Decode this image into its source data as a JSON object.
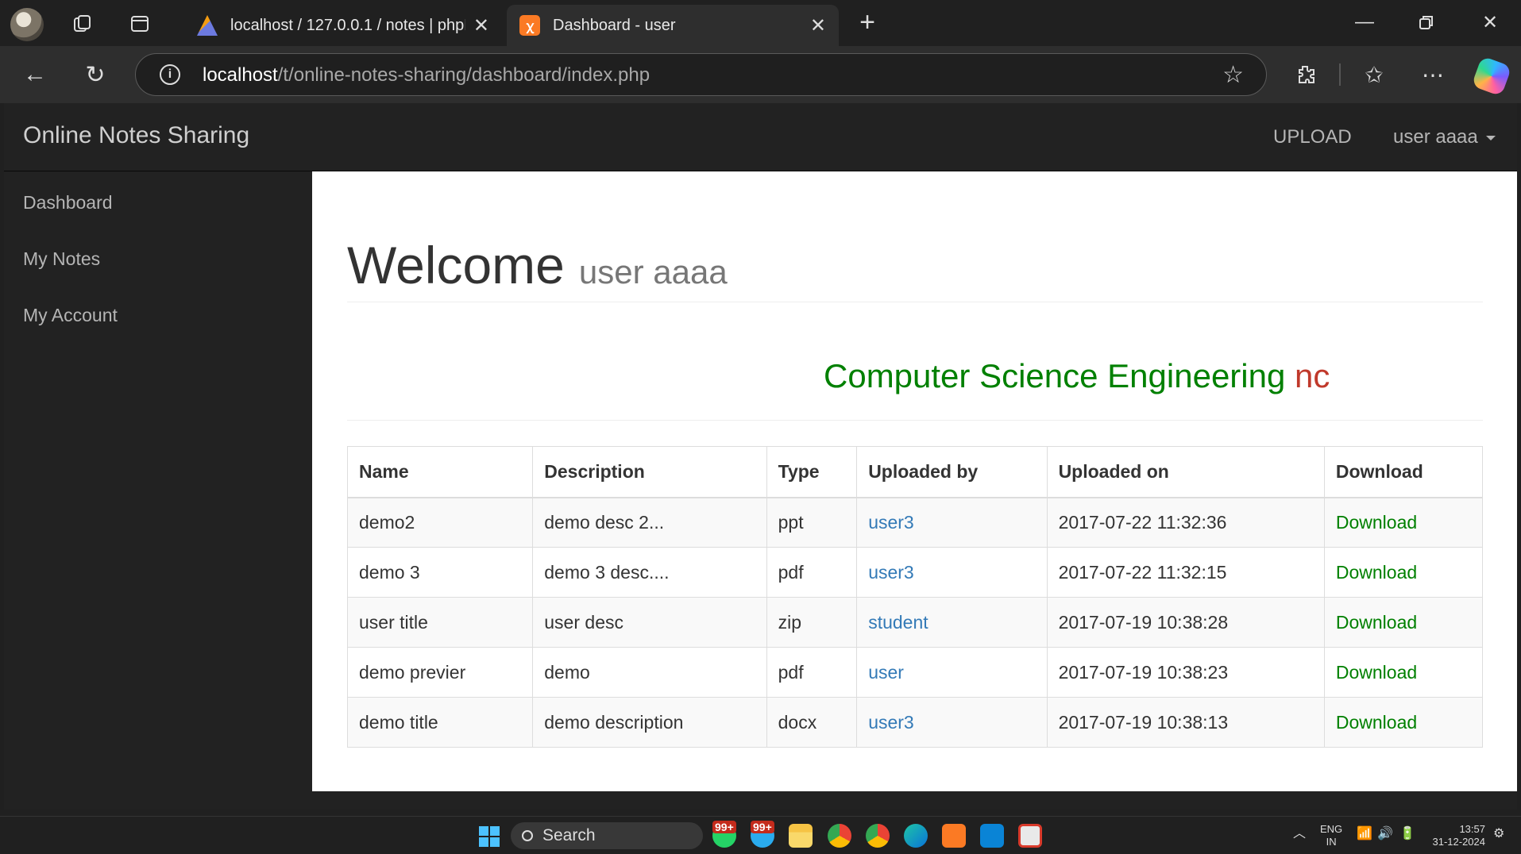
{
  "browser": {
    "tabs": [
      {
        "title": "localhost / 127.0.0.1 / notes | phpMyAdmin",
        "active": false
      },
      {
        "title": "Dashboard - user",
        "active": true
      }
    ],
    "url_host": "localhost",
    "url_path": "/t/online-notes-sharing/dashboard/index.php"
  },
  "navbar": {
    "brand": "Online Notes Sharing",
    "upload": "UPLOAD",
    "user": "user aaaa"
  },
  "sidebar": {
    "items": [
      {
        "label": "Dashboard"
      },
      {
        "label": "My Notes"
      },
      {
        "label": "My Account"
      }
    ]
  },
  "main": {
    "welcome": "Welcome",
    "username": "user aaaa",
    "marquee": "Computer Science Engineering",
    "marquee_tail": "nc",
    "table": {
      "headers": [
        "Name",
        "Description",
        "Type",
        "Uploaded by",
        "Uploaded on",
        "Download"
      ],
      "rows": [
        {
          "name": "demo2",
          "description": "demo desc 2...",
          "type": "ppt",
          "uploaded_by": "user3",
          "uploaded_on": "2017-07-22 11:32:36",
          "download": "Download"
        },
        {
          "name": "demo 3",
          "description": "demo 3 desc....",
          "type": "pdf",
          "uploaded_by": "user3",
          "uploaded_on": "2017-07-22 11:32:15",
          "download": "Download"
        },
        {
          "name": "user title",
          "description": "user desc",
          "type": "zip",
          "uploaded_by": "student",
          "uploaded_on": "2017-07-19 10:38:28",
          "download": "Download"
        },
        {
          "name": "demo previer",
          "description": "demo",
          "type": "pdf",
          "uploaded_by": "user",
          "uploaded_on": "2017-07-19 10:38:23",
          "download": "Download"
        },
        {
          "name": "demo title",
          "description": "demo description",
          "type": "docx",
          "uploaded_by": "user3",
          "uploaded_on": "2017-07-19 10:38:13",
          "download": "Download"
        }
      ]
    }
  },
  "taskbar": {
    "search": "Search",
    "badge": "99+",
    "lang": "ENG",
    "region": "IN",
    "time": "13:57",
    "date": "31-12-2024"
  },
  "colors": {
    "accent_green": "#008000",
    "link_blue": "#337ab7",
    "navbar_bg": "#222222"
  }
}
